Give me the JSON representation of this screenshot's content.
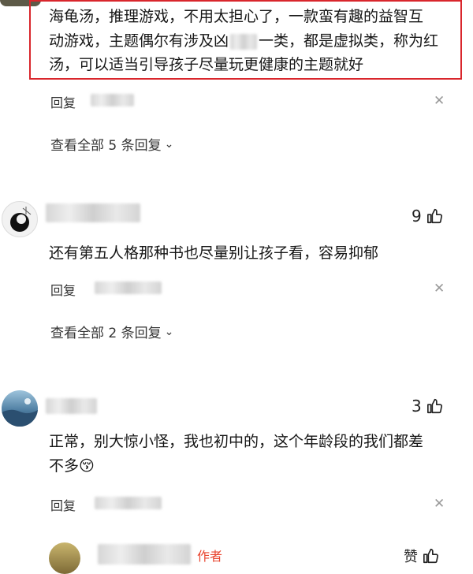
{
  "comment_top": {
    "text_line1": "海龟汤，推理游戏，不用太担心了，一款蛮有趣的益智互",
    "text_line2": "动游戏，主题偶尔有涉及凶",
    "text_line2_tail": "一类，都是虚拟类，称为红",
    "text_line3": "汤，可以适当引导孩子尽量玩更健康的主题就好",
    "reply_label": "回复",
    "view_replies": "查看全部 5 条回复"
  },
  "comment_2": {
    "likes": "9",
    "text": "还有第五人格那种书也尽量别让孩子看，容易抑郁",
    "reply_label": "回复",
    "view_replies": "查看全部 2 条回复"
  },
  "comment_3": {
    "likes": "3",
    "text_line1": "正常，别大惊小怪，我也初中的，这个年龄段的我们都差",
    "text_line2": "不多",
    "emoji": "😚",
    "reply_label": "回复"
  },
  "comment_4": {
    "author_tag": "作者",
    "like_label": "赞"
  },
  "colors": {
    "highlight": "#d9262c",
    "author_tag": "#e8452f"
  }
}
